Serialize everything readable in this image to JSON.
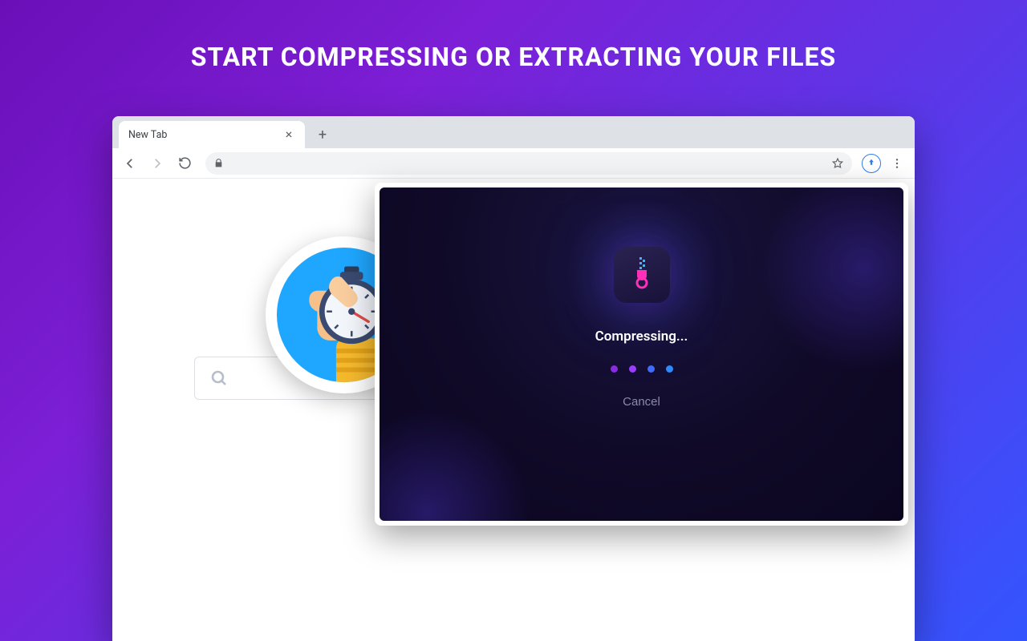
{
  "headline": "START COMPRESSING OR EXTRACTING YOUR FILES",
  "browser": {
    "tab_title": "New Tab",
    "address": ""
  },
  "popup": {
    "status": "Compressing...",
    "cancel_label": "Cancel"
  }
}
